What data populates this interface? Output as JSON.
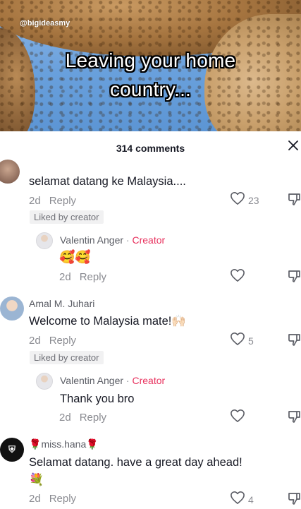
{
  "video": {
    "watermark": "@bigideasmy",
    "caption_line1": "Leaving your home",
    "caption_line2": "country..."
  },
  "header": {
    "comment_count": "314 comments"
  },
  "comments": [
    {
      "username": "",
      "text": "selamat datang ke Malaysia....",
      "time": "2d",
      "reply_label": "Reply",
      "liked_by_creator": "Liked by creator",
      "likes": "23"
    },
    {
      "username": "Valentin Anger",
      "creator_label": "Creator",
      "text": "🥰🥰",
      "time": "2d",
      "reply_label": "Reply",
      "likes": ""
    },
    {
      "username": "Amal M. Juhari",
      "text": "Welcome to Malaysia mate!🙌🏻",
      "time": "2d",
      "reply_label": "Reply",
      "liked_by_creator": "Liked by creator",
      "likes": "5"
    },
    {
      "username": "Valentin Anger",
      "creator_label": "Creator",
      "text": "Thank you bro",
      "time": "2d",
      "reply_label": "Reply",
      "likes": ""
    },
    {
      "username": "miss.hana",
      "username_emoji": "🌹",
      "text": "Selamat datang. have a great day ahead!",
      "text_line2": "💐",
      "time": "2d",
      "reply_label": "Reply",
      "likes": "4"
    }
  ],
  "icons": {
    "close": "close-icon",
    "like": "heart-outline-icon",
    "dislike": "thumbs-down-icon"
  },
  "colors": {
    "creator_accent": "#e8325e",
    "secondary_text": "#8a8b91",
    "chip_bg": "#f1f1f2"
  }
}
